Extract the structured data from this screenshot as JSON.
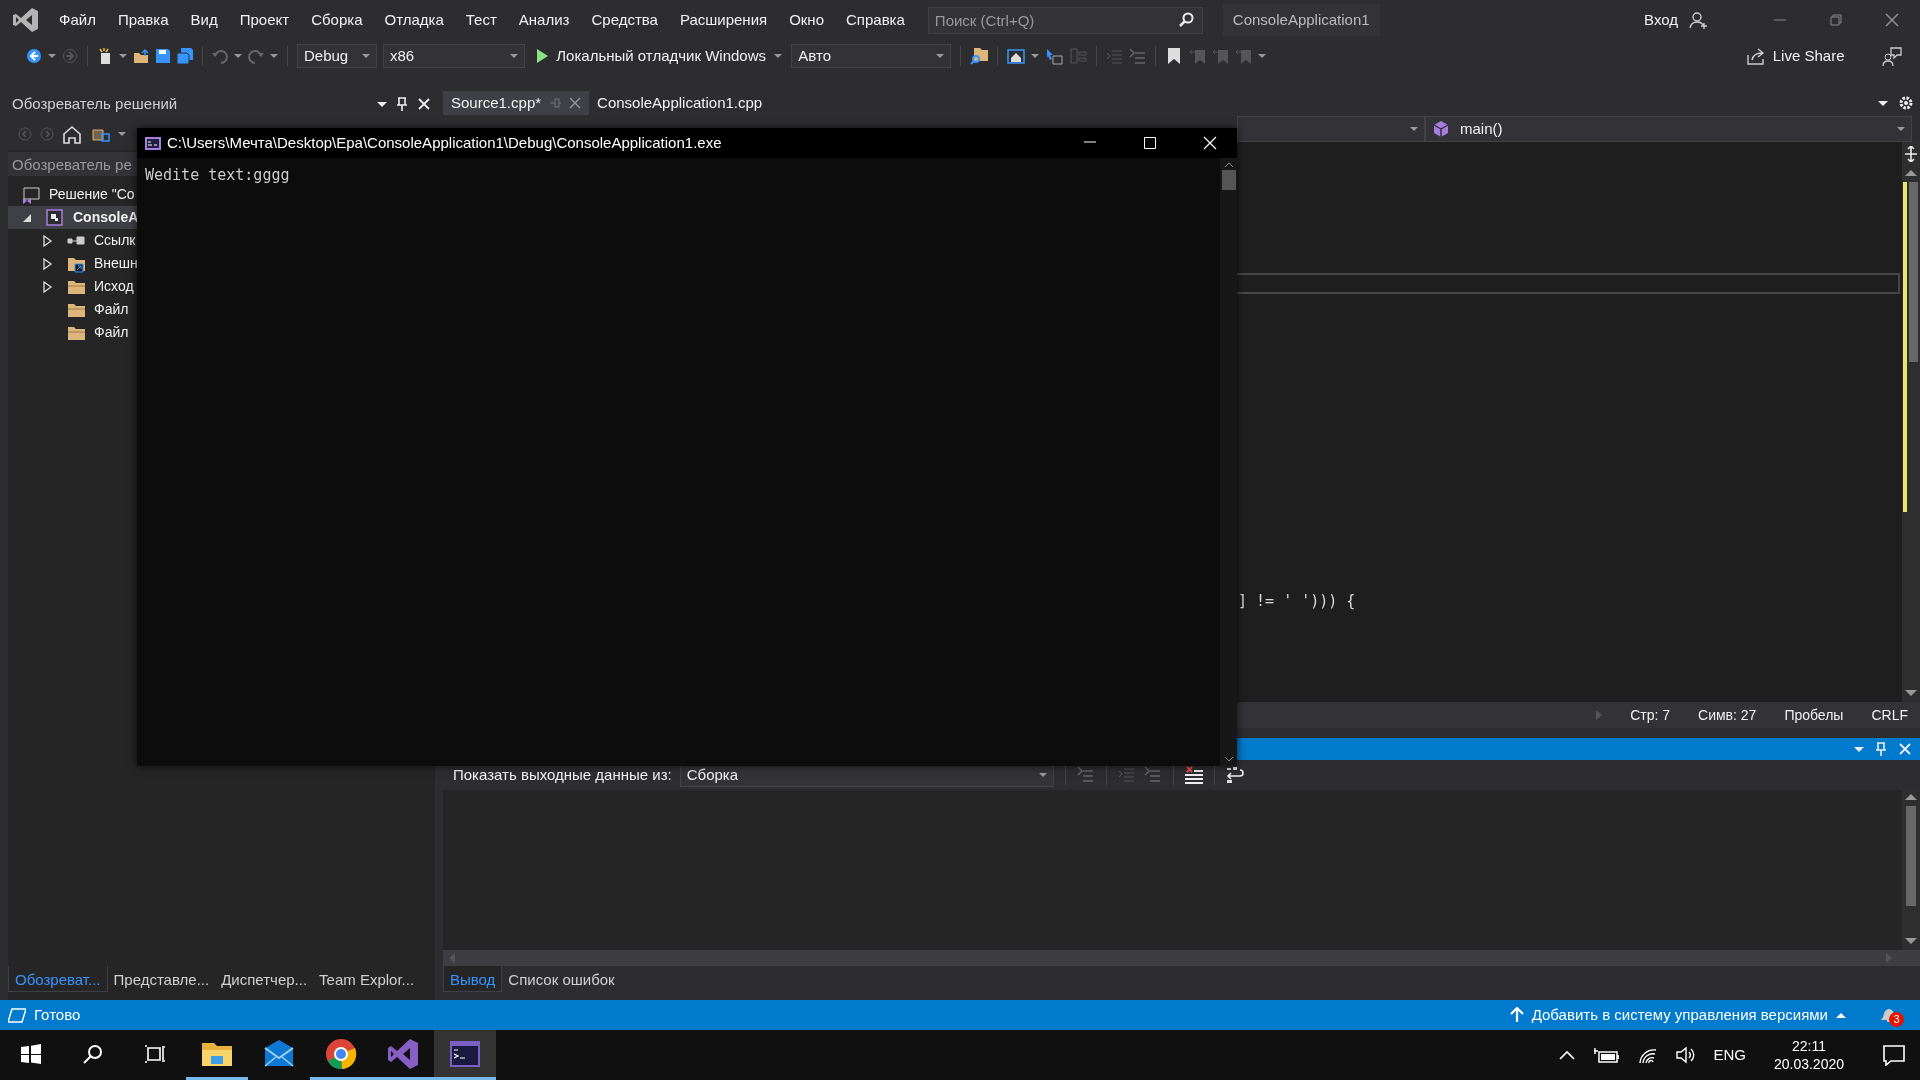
{
  "menu": [
    "Файл",
    "Правка",
    "Вид",
    "Проект",
    "Сборка",
    "Отладка",
    "Тест",
    "Анализ",
    "Средства",
    "Расширения",
    "Окно",
    "Справка"
  ],
  "search": {
    "placeholder": "Поиск (Ctrl+Q)"
  },
  "solution_name": "ConsoleApplication1",
  "sign_in": "Вход",
  "toolbar": {
    "configuration": "Debug",
    "platform": "x86",
    "debugger": "Локальный отладчик Windows",
    "target": "Авто",
    "live_share": "Live Share"
  },
  "solution_explorer": {
    "title": "Обозреватель решений",
    "search_placeholder": "Обозреватель ре",
    "tree": [
      {
        "label": "Решение \"Со",
        "expandable": false,
        "selected": false,
        "bold": false,
        "kind": "solution",
        "children": [
          {
            "label": "ConsoleA",
            "expandable": true,
            "expanded": true,
            "selected": true,
            "bold": true,
            "kind": "project",
            "children": [
              {
                "label": "Ссылк",
                "expandable": true,
                "expanded": false,
                "selected": false,
                "bold": false,
                "kind": "references"
              },
              {
                "label": "Внешн",
                "expandable": true,
                "expanded": false,
                "selected": false,
                "bold": false,
                "kind": "external"
              },
              {
                "label": "Исход",
                "expandable": true,
                "expanded": false,
                "selected": false,
                "bold": false,
                "kind": "folder"
              },
              {
                "label": "Файл",
                "expandable": false,
                "selected": false,
                "bold": false,
                "kind": "folder"
              },
              {
                "label": "Файл",
                "expandable": false,
                "selected": false,
                "bold": false,
                "kind": "folder"
              }
            ]
          }
        ]
      }
    ],
    "tabs": [
      {
        "label": "Обозреват...",
        "selected": true
      },
      {
        "label": "Представле...",
        "selected": false
      },
      {
        "label": "Диспетчер...",
        "selected": false
      },
      {
        "label": "Team Explor...",
        "selected": false
      }
    ]
  },
  "editor": {
    "tabs": [
      {
        "label": "Source1.cpp*",
        "selected": true
      },
      {
        "label": "ConsoleApplication1.cpp",
        "selected": false
      }
    ],
    "member": "main()",
    "code_line": "] != ' '))) {",
    "status": [
      "Стр: 7",
      "Симв: 27",
      "Пробелы",
      "CRLF"
    ]
  },
  "output": {
    "label": "Показать выходные данные из:",
    "source": "Сборка",
    "tabs": [
      {
        "label": "Вывод",
        "selected": true
      },
      {
        "label": "Список ошибок",
        "selected": false
      }
    ]
  },
  "console": {
    "title": "C:\\Users\\Мечта\\Desktop\\Ера\\ConsoleApplication1\\Debug\\ConsoleApplication1.exe",
    "lines": [
      "Wedite text:gggg"
    ]
  },
  "status_bar": {
    "text": "Готово",
    "scm": "Добавить в систему управления версиями",
    "notifications": "3"
  },
  "taskbar": {
    "apps": [
      {
        "kind": "folder",
        "running": true,
        "selected": false
      },
      {
        "kind": "mail",
        "running": false,
        "selected": false
      },
      {
        "kind": "browser",
        "running": true,
        "selected": false
      },
      {
        "kind": "ide",
        "running": true,
        "selected": false
      },
      {
        "kind": "terminal",
        "running": true,
        "selected": true
      }
    ],
    "language": "ENG",
    "time": "22:11",
    "date": "20.03.2020"
  }
}
